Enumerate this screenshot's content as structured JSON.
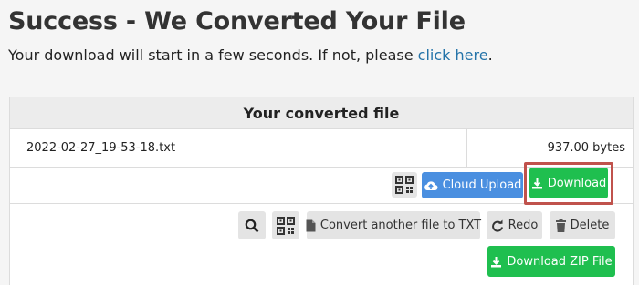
{
  "header": {
    "title": "Success - We Converted Your File",
    "subtitle_prefix": "Your download will start in a few seconds. If not, please ",
    "subtitle_link": "click here",
    "subtitle_suffix": "."
  },
  "card": {
    "heading": "Your converted file",
    "file": {
      "name": "2022-02-27_19-53-18.txt",
      "size": "937.00 bytes"
    }
  },
  "actions": {
    "cloud_upload_label": "Cloud Upload",
    "download_label": "Download",
    "convert_label": "Convert another file to TXT",
    "redo_label": "Redo",
    "delete_label": "Delete",
    "download_zip_label": "Download ZIP File"
  },
  "icons": {
    "qr": "qr-code-icon",
    "cloud": "cloud-upload-icon",
    "download": "download-icon",
    "search": "search-icon",
    "file": "file-icon",
    "redo": "redo-icon",
    "trash": "trash-icon"
  },
  "colors": {
    "link": "#2574a9",
    "blue_button": "#4a8fe0",
    "green_button": "#1fbf4f",
    "highlight": "#c0524c"
  }
}
